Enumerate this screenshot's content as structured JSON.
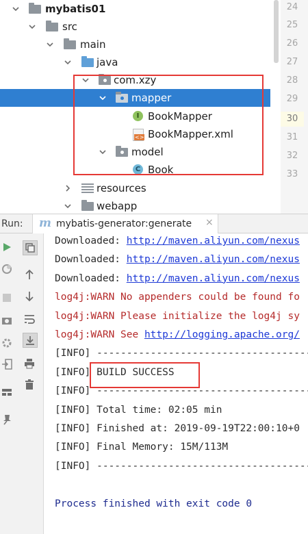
{
  "project_tree": {
    "items": [
      {
        "label": "mybatis01",
        "icon": "module-folder-icon",
        "expanded": true,
        "bold": true
      },
      {
        "label": "src",
        "icon": "folder-icon",
        "expanded": true
      },
      {
        "label": "main",
        "icon": "folder-icon",
        "expanded": true
      },
      {
        "label": "java",
        "icon": "source-folder-icon",
        "expanded": true
      },
      {
        "label": "com.xzy",
        "icon": "package-icon",
        "expanded": true
      },
      {
        "label": "mapper",
        "icon": "package-icon",
        "expanded": true,
        "selected": true
      },
      {
        "label": "BookMapper",
        "icon": "interface-icon",
        "badge": "I"
      },
      {
        "label": "BookMapper.xml",
        "icon": "xml-file-icon"
      },
      {
        "label": "model",
        "icon": "package-icon",
        "expanded": true
      },
      {
        "label": "Book",
        "icon": "class-icon",
        "badge": "C"
      },
      {
        "label": "resources",
        "icon": "resources-folder-icon",
        "expanded": false
      },
      {
        "label": "webapp",
        "icon": "folder-icon",
        "expanded": true
      }
    ]
  },
  "gutter": {
    "line_numbers": [
      "24",
      "25",
      "26",
      "27",
      "28",
      "29",
      "30",
      "31",
      "32",
      "33"
    ],
    "current_line": "30"
  },
  "run_panel": {
    "label": "Run:",
    "tab": {
      "icon": "maven-icon",
      "icon_glyph": "m",
      "title": "mybatis-generator:generate",
      "close": "×"
    },
    "toolbar": [
      "rerun-icon",
      "restore-layout-icon",
      "stop-icon",
      "camera-icon",
      "settings-icon",
      "login-icon",
      "layout-icon",
      "pin-icon",
      "up-arrow-icon",
      "down-arrow-icon",
      "soft-wrap-icon",
      "scroll-to-end-icon",
      "print-icon",
      "trash-icon"
    ],
    "console": {
      "lines": [
        {
          "type": "normal",
          "prefix": "Downloaded: ",
          "link": "http://maven.aliyun.com/nexus"
        },
        {
          "type": "normal",
          "prefix": "Downloaded: ",
          "link": "http://maven.aliyun.com/nexus"
        },
        {
          "type": "normal",
          "prefix": "Downloaded: ",
          "link": "http://maven.aliyun.com/nexus"
        },
        {
          "type": "warn",
          "prefix": "log4j:WARN No appenders could be found fo",
          "link": ""
        },
        {
          "type": "warn",
          "prefix": "log4j:WARN Please initialize the log4j sy",
          "link": ""
        },
        {
          "type": "warn",
          "prefix": "log4j:WARN See ",
          "link": "http://logging.apache.org/"
        },
        {
          "type": "normal",
          "prefix": "[INFO] ------------------------------------",
          "link": ""
        },
        {
          "type": "normal",
          "prefix": "[INFO] BUILD SUCCESS",
          "link": ""
        },
        {
          "type": "normal",
          "prefix": "[INFO] ------------------------------------",
          "link": ""
        },
        {
          "type": "normal",
          "prefix": "[INFO] Total time: 02:05 min",
          "link": ""
        },
        {
          "type": "normal",
          "prefix": "[INFO] Finished at: 2019-09-19T22:00:10+0",
          "link": ""
        },
        {
          "type": "normal",
          "prefix": "[INFO] Final Memory: 15M/113M",
          "link": ""
        },
        {
          "type": "normal",
          "prefix": "[INFO] ------------------------------------",
          "link": ""
        },
        {
          "type": "blank",
          "prefix": "",
          "link": ""
        },
        {
          "type": "proc",
          "prefix": "Process finished with exit code 0",
          "link": ""
        }
      ]
    }
  },
  "colors": {
    "selection": "#2f7fd1",
    "highlight_box": "#e53935",
    "link": "#1d39d6",
    "warn": "#b52a2a",
    "process": "#1d2b8f"
  }
}
